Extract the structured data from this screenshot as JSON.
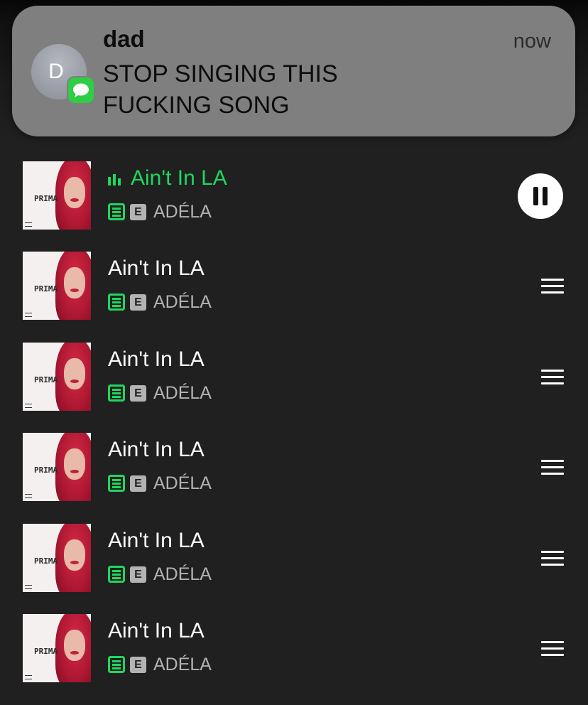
{
  "notification": {
    "avatar_letter": "D",
    "app_icon": "messages-icon",
    "sender": "dad",
    "time": "now",
    "message": "STOP SINGING THIS FUCKING SONG"
  },
  "queue": [
    {
      "title": "Ain't In LA",
      "artist": "ADÉLA",
      "explicit": "E",
      "downloaded": true,
      "playing": true,
      "cover_text": "PRIMA",
      "action_icon": "pause-icon"
    },
    {
      "title": "Ain't In LA",
      "artist": "ADÉLA",
      "explicit": "E",
      "downloaded": true,
      "playing": false,
      "cover_text": "PRIMA",
      "action_icon": "drag-handle-icon"
    },
    {
      "title": "Ain't In LA",
      "artist": "ADÉLA",
      "explicit": "E",
      "downloaded": true,
      "playing": false,
      "cover_text": "PRIMA",
      "action_icon": "drag-handle-icon"
    },
    {
      "title": "Ain't In LA",
      "artist": "ADÉLA",
      "explicit": "E",
      "downloaded": true,
      "playing": false,
      "cover_text": "PRIMA",
      "action_icon": "drag-handle-icon"
    },
    {
      "title": "Ain't In LA",
      "artist": "ADÉLA",
      "explicit": "E",
      "downloaded": true,
      "playing": false,
      "cover_text": "PRIMA",
      "action_icon": "drag-handle-icon"
    },
    {
      "title": "Ain't In LA",
      "artist": "ADÉLA",
      "explicit": "E",
      "downloaded": true,
      "playing": false,
      "cover_text": "PRIMA",
      "action_icon": "drag-handle-icon"
    }
  ],
  "colors": {
    "accent": "#1ed760",
    "background": "#202020",
    "notification_bg": "#7f7f7f",
    "secondary_text": "#b3b3b3"
  }
}
